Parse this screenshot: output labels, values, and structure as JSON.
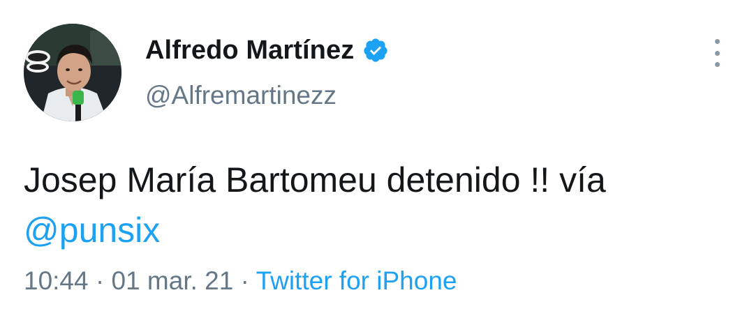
{
  "user": {
    "display_name": "Alfredo Martínez",
    "handle": "@Alfremartinezz",
    "verified": true
  },
  "tweet": {
    "text_main": "Josep María Bartomeu detenido !! vía",
    "mention": "@punsix",
    "time": "10:44",
    "separator": "·",
    "date": "01 mar. 21",
    "source": "Twitter for iPhone"
  },
  "icons": {
    "verified": "verified-badge-icon",
    "more": "more-vertical-icon",
    "avatar": "user-avatar"
  },
  "colors": {
    "link": "#1da1f2",
    "secondary_text": "#657786",
    "primary_text": "#14171a"
  }
}
